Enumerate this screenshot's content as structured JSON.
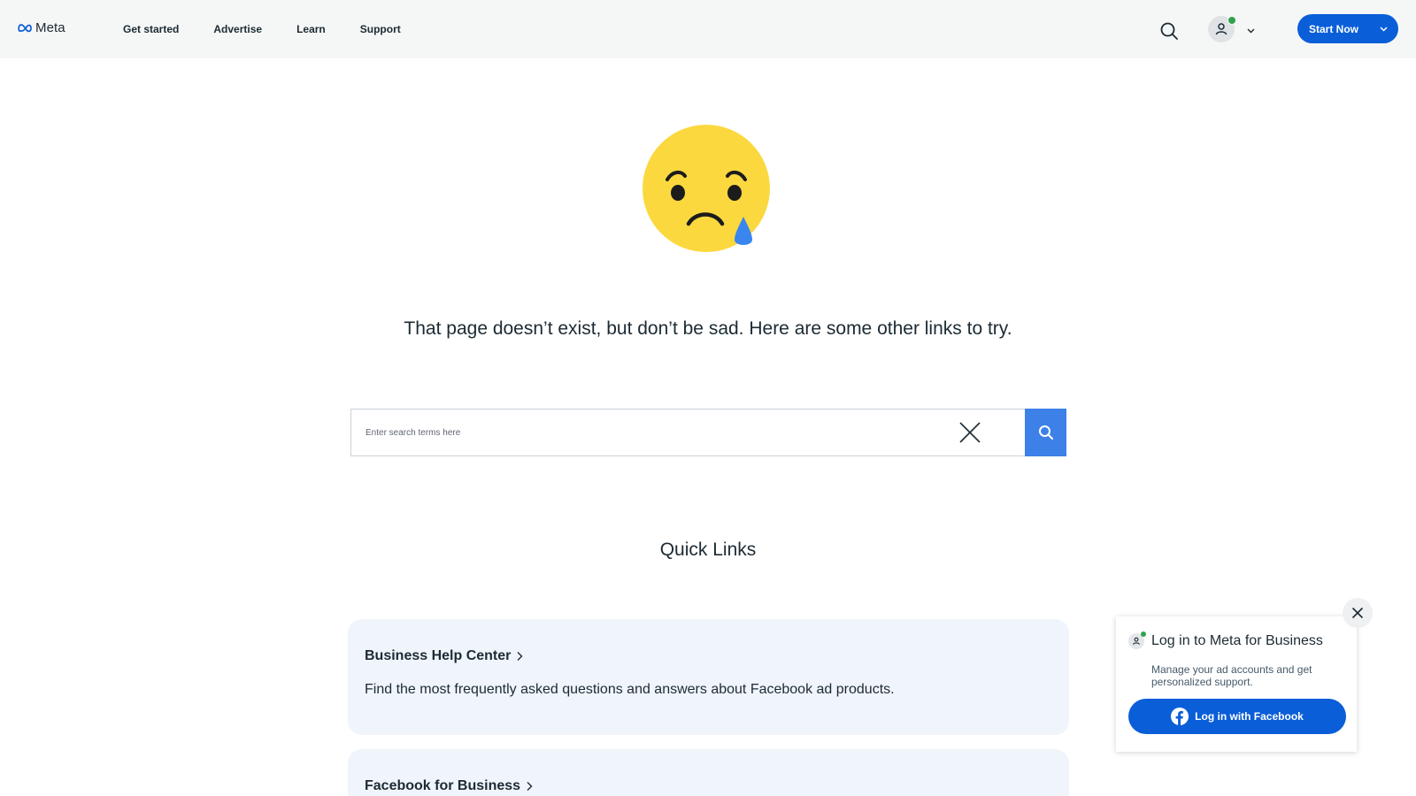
{
  "header": {
    "logo_text": "Meta",
    "nav": [
      "Get started",
      "Advertise",
      "Learn",
      "Support"
    ],
    "start_now_label": "Start Now"
  },
  "main": {
    "message": "That page doesn’t exist, but don’t be sad. Here are some other links to try.",
    "search": {
      "placeholder": "Enter search terms here",
      "value": ""
    },
    "quick_links_title": "Quick Links",
    "cards": [
      {
        "title": "Business Help Center",
        "description": "Find the most frequently asked questions and answers about Facebook ad products."
      },
      {
        "title": "Facebook for Business",
        "description": ""
      }
    ]
  },
  "login_popup": {
    "title": "Log in to Meta for Business",
    "description": "Manage your ad accounts and get personalized support.",
    "button_label": "Log in with Facebook"
  },
  "colors": {
    "brand_blue": "#0a5ed7",
    "search_blue": "#3d81e8",
    "card_bg": "#f0f4fb",
    "header_bg": "#f5f6f6",
    "status_green": "#31a24c"
  },
  "icons": [
    "meta-logo-icon",
    "search-icon",
    "user-icon",
    "chevron-down-icon",
    "sad-tear-emoji-icon",
    "close-icon",
    "chevron-right-icon",
    "facebook-icon"
  ]
}
